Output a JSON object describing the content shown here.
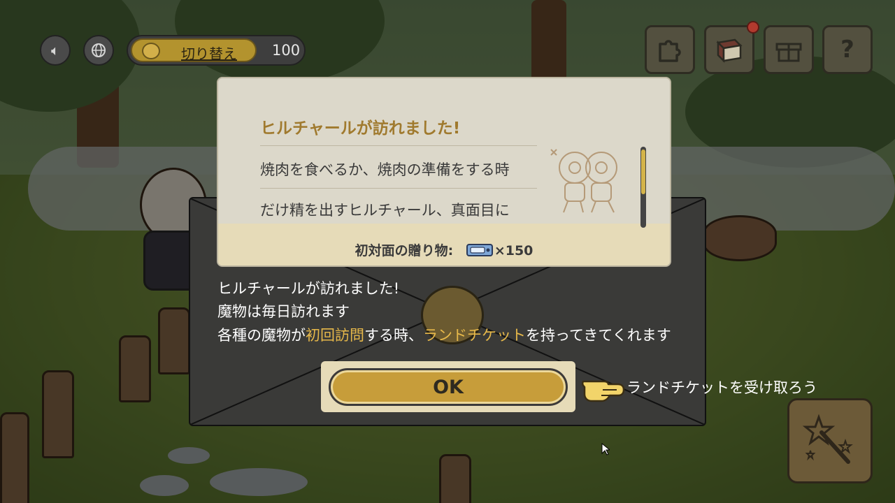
{
  "hud": {
    "sound_icon": "speaker-icon",
    "language_icon": "globe-icon",
    "switch_label": "切り替え",
    "currency_count": "100"
  },
  "top_right": {
    "puzzle_icon": "puzzle-icon",
    "book_icon": "book-icon",
    "gift_icon": "gift-icon",
    "help_icon": "question-icon",
    "help_glyph": "?"
  },
  "letter": {
    "title": "ヒルチャールが訪れました!",
    "lines": [
      "焼肉を食べるか、焼肉の準備をする時",
      "だけ精を出すヒルチャール、真面目に"
    ],
    "gift_label": "初対面の贈り物:",
    "gift_amount": "×150"
  },
  "tutorial": {
    "line1": "ヒルチャールが訪れました!",
    "line2": "魔物は毎日訪れます",
    "line3_a": "各種の魔物が",
    "line3_hl1": "初回訪問",
    "line3_b": "する時、",
    "line3_hl2": "ランドチケット",
    "line3_c": "を持ってきてくれます"
  },
  "ok_button": {
    "label": "OK"
  },
  "hint": "ランドチケットを受け取ろう",
  "colors": {
    "accent_gold": "#c79d3a",
    "highlight": "#e6b84a",
    "letter_title": "#a07a2e"
  }
}
